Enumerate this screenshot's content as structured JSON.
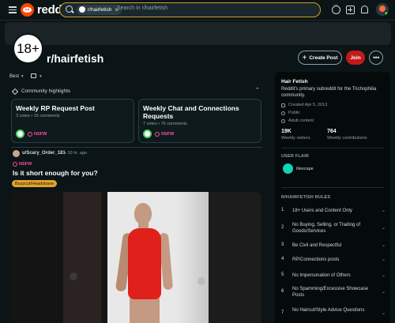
{
  "header": {
    "logo_text": "reddit",
    "search_chip": "r/hairfetish",
    "search_placeholder": "Search in r/hairfetish"
  },
  "subreddit": {
    "icon_text": "18+",
    "title": "r/hairfetish",
    "create_post_label": "Create Post",
    "join_label": "Join",
    "more_label": "•••"
  },
  "feed": {
    "sort_label": "Best"
  },
  "highlights": {
    "header": "Community highlights",
    "cards": [
      {
        "title": "Weekly RP Request Post",
        "meta": "3 votes • 15 comments",
        "tag": "NSFW"
      },
      {
        "title": "Weekly Chat and Connections Requests",
        "meta": "7 votes • 76 comments",
        "tag": "NSFW"
      }
    ]
  },
  "post": {
    "author": "u/Scary_Order_181",
    "time": "• 10 hr. ago",
    "tag": "NSFW",
    "title": "Is it short enough for you?",
    "flair": "Buzzcut/Headshave"
  },
  "sidebar": {
    "title": "Hair Fetish",
    "description": "Reddit's primary subreddit for the Trichophilia community.",
    "created": "Created Apr 5, 2013",
    "visibility": "Public",
    "adult": "Adult content",
    "stats": [
      {
        "value": "19K",
        "label": "Weekly visitors"
      },
      {
        "value": "764",
        "label": "Weekly contributions"
      }
    ],
    "user_flair_header": "USER FLAIR",
    "user_flair_name": "tilescape",
    "rules_header": "R/HAIRFETISH RULES",
    "rules": [
      {
        "num": "1",
        "text": "18+ Users and Content Only"
      },
      {
        "num": "2",
        "text": "No Buying, Selling, or Trading of Goods/Services"
      },
      {
        "num": "3",
        "text": "Be Civil and Respectful"
      },
      {
        "num": "4",
        "text": "RP/Connections posts"
      },
      {
        "num": "5",
        "text": "No Impersonation of Others"
      },
      {
        "num": "6",
        "text": "No Spamming/Excessive Showcase Posts"
      },
      {
        "num": "7",
        "text": "No Haircut/Style Advice Questions"
      }
    ]
  }
}
